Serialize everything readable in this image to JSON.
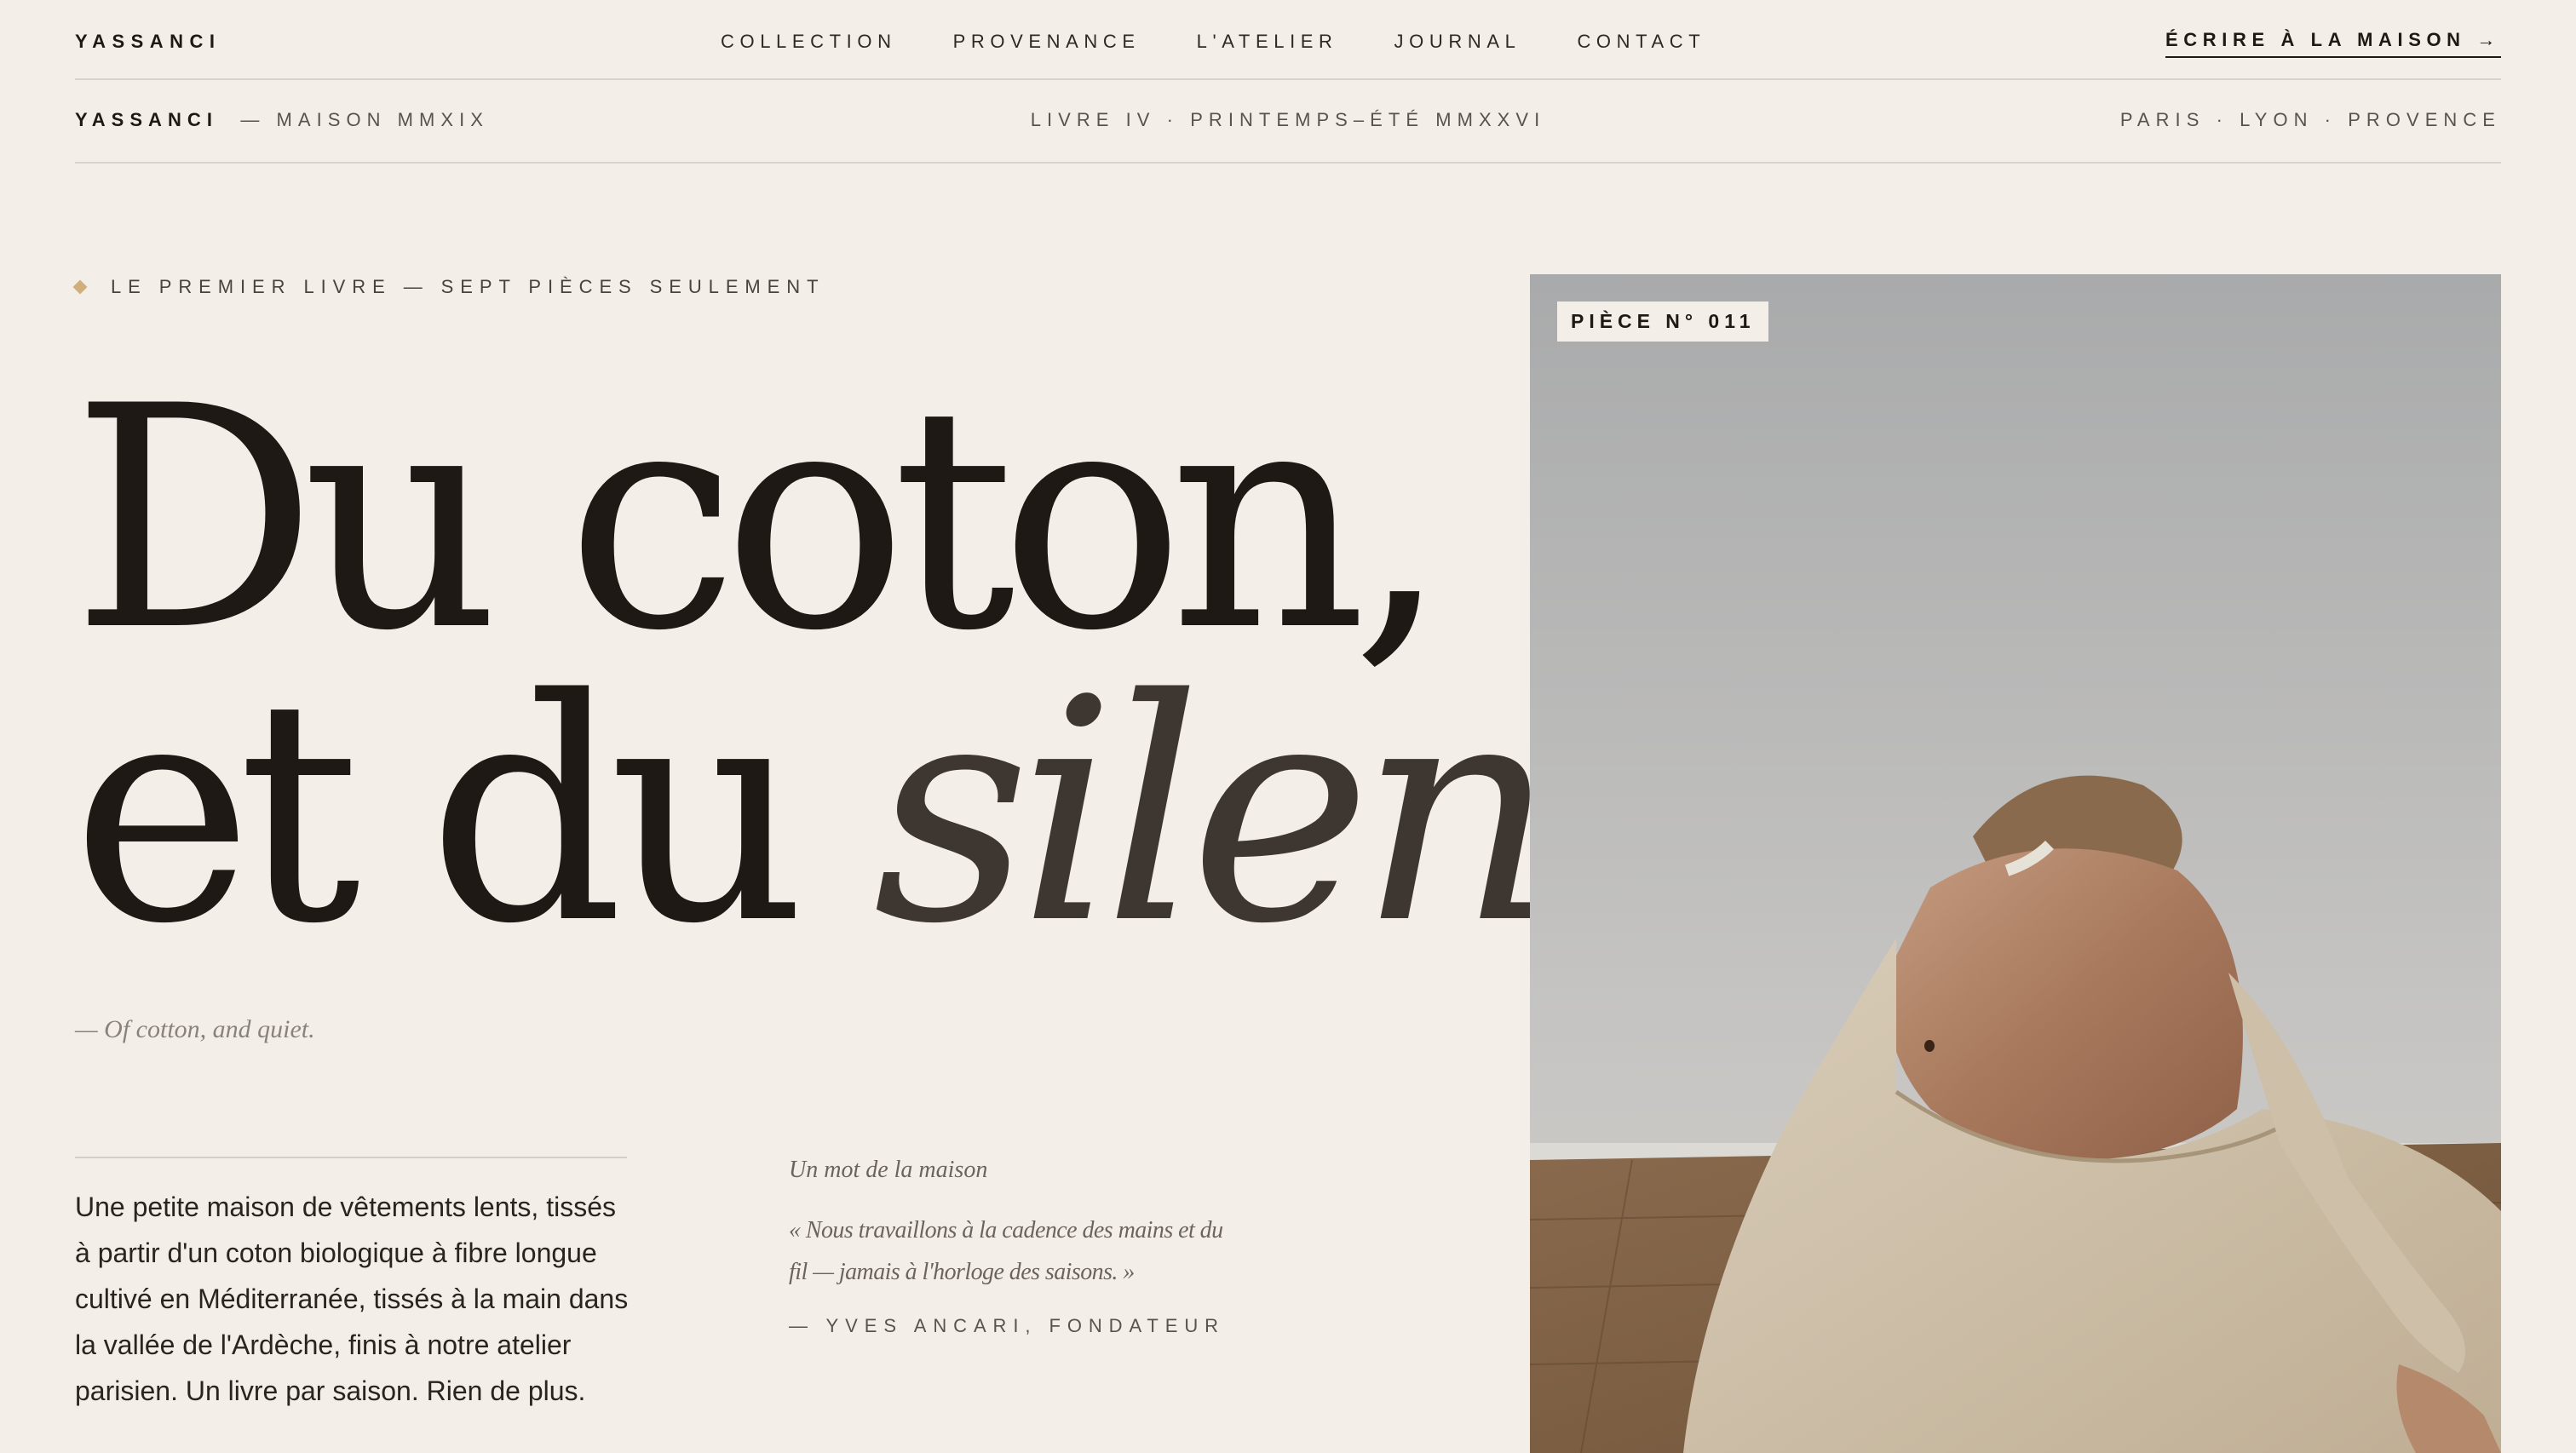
{
  "brand": "YASSANCI",
  "nav": {
    "items": [
      "COLLECTION",
      "PROVENANCE",
      "L'ATELIER",
      "JOURNAL",
      "CONTACT"
    ],
    "cta": "ÉCRIRE À LA MAISON →"
  },
  "subbar": {
    "brand": "YASSANCI",
    "brand_suffix": "— MAISON MMXIX",
    "edition": "LIVRE IV · PRINTEMPS–ÉTÉ MMXXVI",
    "cities": "PARIS · LYON · PROVENCE"
  },
  "hero": {
    "eyebrow": "LE PREMIER LIVRE — SEPT PIÈCES SEULEMENT",
    "headline_line1": "Du coton,",
    "headline_line2_plain": "et du ",
    "headline_line2_italic": "silence.",
    "translation": "— Of cotton, and quiet.",
    "body": "Une petite maison de vêtements lents, tissés à partir d'un coton biologique à fibre longue cultivé en Méditerranée, tissés à la main dans la vallée de l'Ardèche, finis à notre atelier parisien. Un livre par saison. Rien de plus.",
    "quote_label": "Un mot de la maison",
    "quote": "« Nous travaillons à la cadence des mains et du fil — jamais à l'horloge des saisons. »",
    "quote_author": "— YVES ANCARI, FONDATEUR",
    "piece_badge": "PIÈCE N° 011"
  },
  "colors": {
    "background": "#f3efe8",
    "ink": "#1f1915",
    "accent": "#c9a36a"
  },
  "icons": {
    "eyebrow_marker": "diamond-icon"
  }
}
